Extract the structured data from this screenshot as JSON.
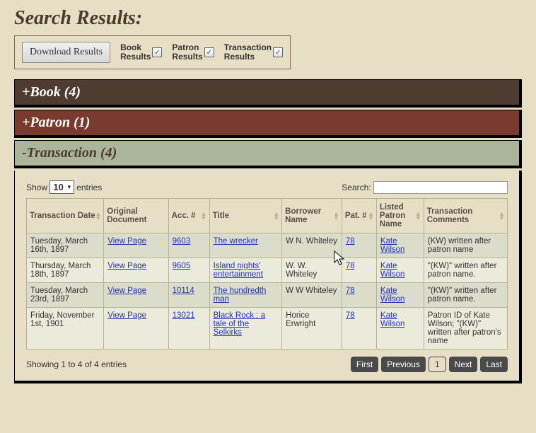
{
  "heading": "Search Results:",
  "download": {
    "button": "Download Results",
    "checks": [
      {
        "label": "Book\nResults",
        "checked": true
      },
      {
        "label": "Patron\nResults",
        "checked": true
      },
      {
        "label": "Transaction\nResults",
        "checked": true
      }
    ]
  },
  "accordion": {
    "book": "+Book (4)",
    "patron": "+Patron (1)",
    "transaction": "-Transaction (4)"
  },
  "table_controls": {
    "show_prefix": "Show",
    "show_value": "10",
    "show_suffix": "entries",
    "search_label": "Search:",
    "search_value": ""
  },
  "columns": [
    "Transaction Date",
    "Original Document",
    "Acc. #",
    "Title",
    "Borrower Name",
    "Pat. #",
    "Listed Patron Name",
    "Transaction Comments"
  ],
  "rows": [
    {
      "date": "Tuesday, March 16th, 1897",
      "doc": "View Page",
      "acc": "9603",
      "title": "The wrecker",
      "borrower": "W N. Whiteley",
      "pat": "78",
      "listed": "Kate Wilson",
      "comments": "(KW) written after patron name"
    },
    {
      "date": "Thursday, March 18th, 1897",
      "doc": "View Page",
      "acc": "9605",
      "title": "Island nights' entertainment",
      "borrower": "W. W. Whiteley",
      "pat": "78",
      "listed": "Kate Wilson",
      "comments": "\"(KW)\" written after patron name."
    },
    {
      "date": "Tuesday, March 23rd, 1897",
      "doc": "View Page",
      "acc": "10114",
      "title": "The hundredth man",
      "borrower": "W W Whiteley",
      "pat": "78",
      "listed": "Kate Wilson",
      "comments": "\"(KW)\" written after patron name."
    },
    {
      "date": "Friday, November 1st, 1901",
      "doc": "View Page",
      "acc": "13021",
      "title": "Black Rock : a tale of the Selkirks",
      "borrower": "Horice Erwright",
      "pat": "78",
      "listed": "Kate Wilson",
      "comments": "Patron ID of Kate Wilson; \"(KW)\" written after patron's name"
    }
  ],
  "footer": {
    "info": "Showing 1 to 4 of 4 entries",
    "first": "First",
    "prev": "Previous",
    "page": "1",
    "next": "Next",
    "last": "Last"
  }
}
